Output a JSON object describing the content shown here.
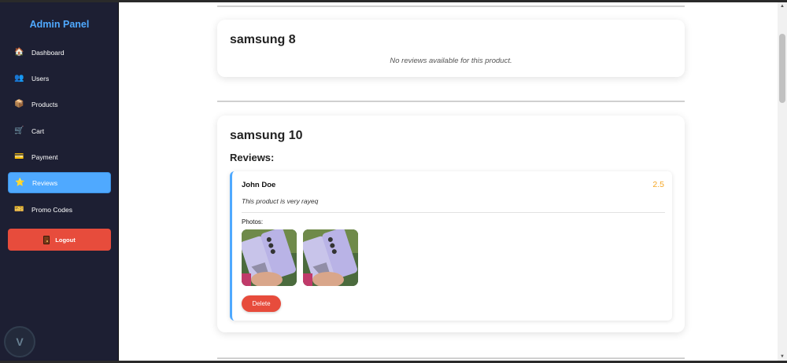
{
  "sidebar": {
    "title": "Admin Panel",
    "items": [
      {
        "label": "Dashboard",
        "icon": "home-icon",
        "glyph": "🏠"
      },
      {
        "label": "Users",
        "icon": "users-icon",
        "glyph": "👥"
      },
      {
        "label": "Products",
        "icon": "box-icon",
        "glyph": "📦"
      },
      {
        "label": "Cart",
        "icon": "cart-icon",
        "glyph": "🛒"
      },
      {
        "label": "Payment",
        "icon": "card-icon",
        "glyph": "💳"
      },
      {
        "label": "Reviews",
        "icon": "star-icon",
        "glyph": "⭐"
      },
      {
        "label": "Promo Codes",
        "icon": "ticket-icon",
        "glyph": "🎫"
      }
    ],
    "active": "Reviews",
    "logout_label": "Logout"
  },
  "products": [
    {
      "name": "samsung 8",
      "empty_message": "No reviews available for this product."
    },
    {
      "name": "samsung 10",
      "reviews_heading": "Reviews:",
      "reviews": [
        {
          "reviewer": "John Doe",
          "rating": "2.5",
          "comment": "This product is very rayeq",
          "photos_label": "Photos:",
          "photo_count": 2,
          "delete_label": "Delete"
        }
      ]
    }
  ],
  "colors": {
    "sidebar_bg": "#1d1f33",
    "accent": "#4fa9ff",
    "danger": "#e74c3c",
    "rating": "#f5a623"
  }
}
